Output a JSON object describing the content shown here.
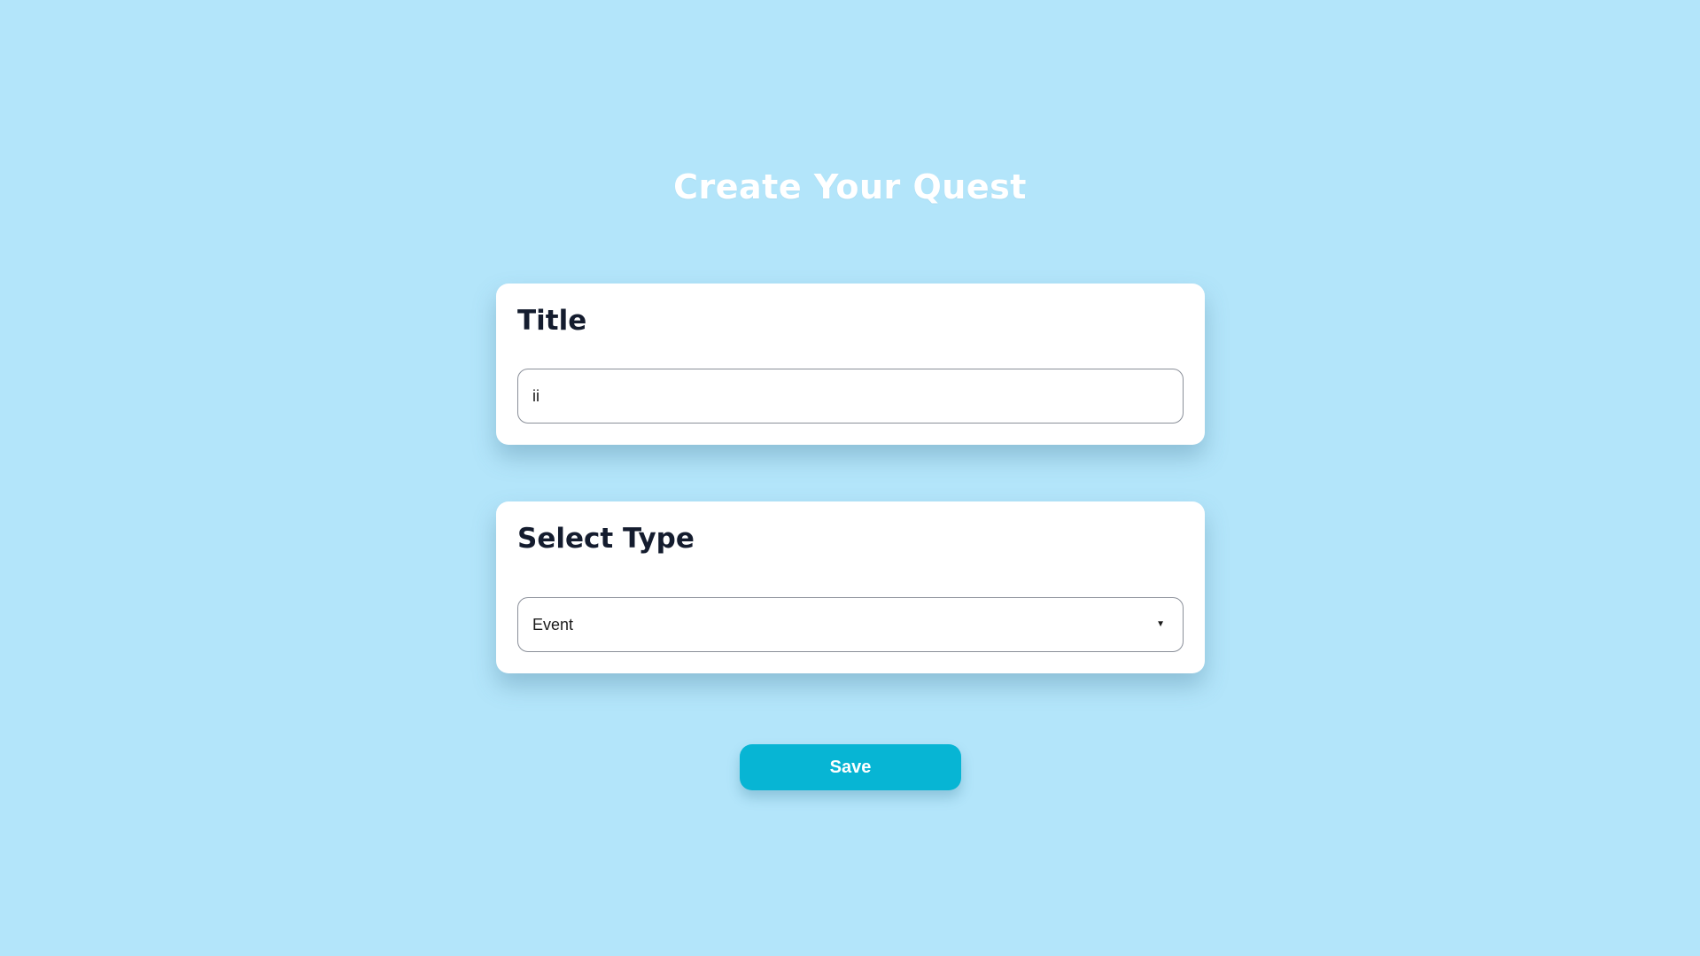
{
  "page": {
    "title": "Create Your Quest"
  },
  "title_card": {
    "heading": "Title",
    "input_value": "ii"
  },
  "type_card": {
    "heading": "Select Type",
    "selected": "Event",
    "chevron_icon": "▼"
  },
  "actions": {
    "save_label": "Save"
  },
  "colors": {
    "background": "#b3e5fa",
    "accent": "#07b5d4",
    "heading_text": "#141c2e"
  }
}
